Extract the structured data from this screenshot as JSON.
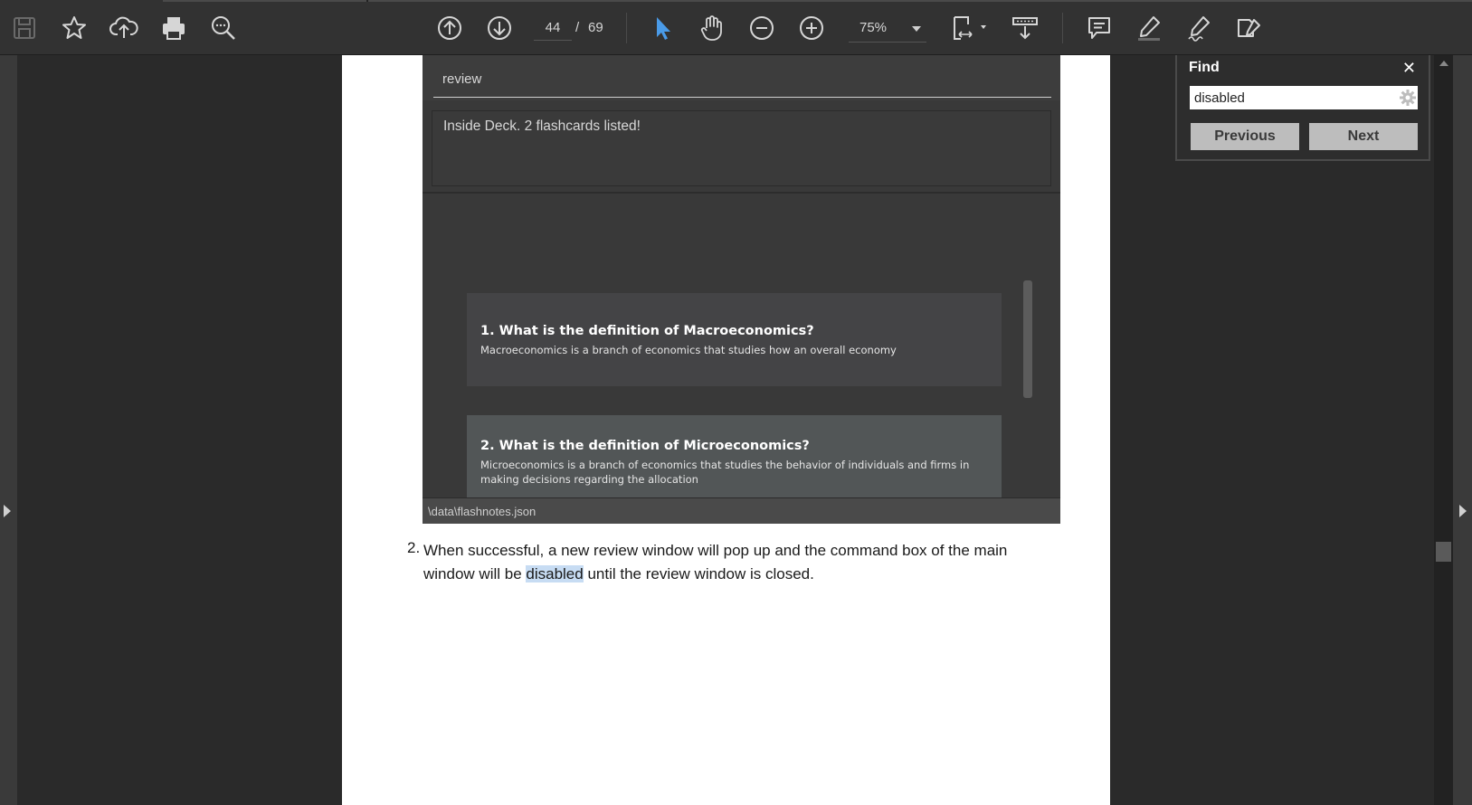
{
  "toolbar": {
    "page_current": "44",
    "page_separator": "/",
    "page_total": "69",
    "zoom": "75%",
    "icons": [
      "save-icon",
      "star-icon",
      "upload-icon",
      "print-icon",
      "search-icon",
      "page-up-icon",
      "page-down-icon",
      "select-cursor-icon",
      "hand-icon",
      "zoom-out-icon",
      "zoom-in-icon",
      "fit-page-icon",
      "scroll-mode-icon",
      "comment-icon",
      "highlight-icon",
      "sign-icon",
      "edit-icon"
    ]
  },
  "embedded_app": {
    "command_text": "review",
    "result_text": "Inside Deck. 2 flashcards listed!",
    "cards": [
      {
        "question": "1.  What is the definition of Macroeconomics?",
        "answer": "Macroeconomics is a branch of economics that studies how an overall economy"
      },
      {
        "question": "2.  What is the definition of Microeconomics?",
        "answer": "Microeconomics is a branch of economics that studies the behavior of individuals and firms in making decisions regarding the allocation"
      }
    ],
    "status_path": "\\data\\flashnotes.json"
  },
  "document": {
    "list_number": "2.",
    "para_before": "When successful, a new review window will pop up and the command box of the main window will be ",
    "para_highlight": "disabled",
    "para_after": " until the review window is closed."
  },
  "find": {
    "title": "Find",
    "close": "✕",
    "query": "disabled",
    "previous_label": "Previous",
    "next_label": "Next"
  },
  "colors": {
    "accent_cursor": "#4a9be8",
    "highlight": "#c7dcf3"
  }
}
